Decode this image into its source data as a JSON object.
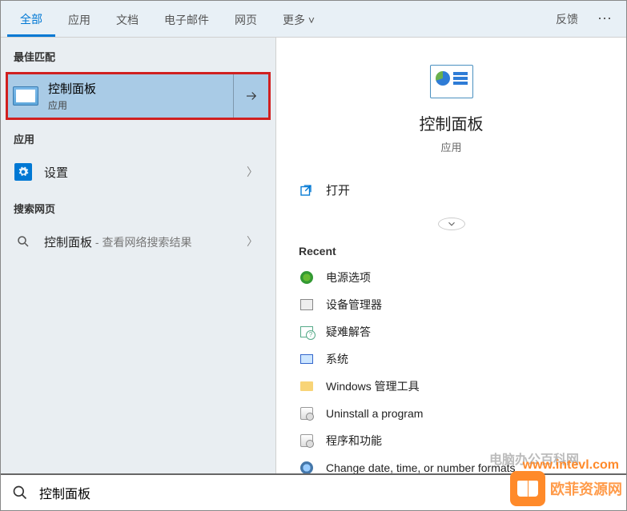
{
  "tabs": {
    "items": [
      "全部",
      "应用",
      "文档",
      "电子邮件",
      "网页",
      "更多"
    ],
    "feedback": "反馈"
  },
  "left": {
    "bestHeader": "最佳匹配",
    "bestMatch": {
      "title": "控制面板",
      "subtitle": "应用"
    },
    "appsHeader": "应用",
    "settings": "设置",
    "webHeader": "搜索网页",
    "webSearch": {
      "term": "控制面板",
      "suffix": " - 查看网络搜索结果"
    }
  },
  "right": {
    "heroTitle": "控制面板",
    "heroSub": "应用",
    "open": "打开",
    "recentHeader": "Recent",
    "recent": [
      "电源选项",
      "设备管理器",
      "疑难解答",
      "系统",
      "Windows 管理工具",
      "Uninstall a program",
      "程序和功能",
      "Change date, time, or number formats"
    ]
  },
  "search": {
    "value": "控制面板"
  },
  "watermark": {
    "cn": "电脑办公百科网",
    "brand": "欧菲资源网",
    "url": "www.intevl.com"
  }
}
